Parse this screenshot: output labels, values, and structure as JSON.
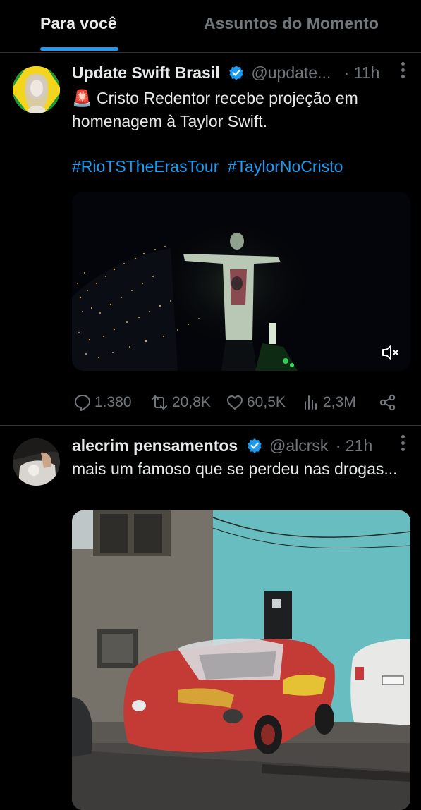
{
  "tabs": {
    "for_you": "Para você",
    "trending": "Assuntos do Momento"
  },
  "colors": {
    "accent": "#1d9bf0",
    "muted": "#71767b",
    "text": "#e7e9ea",
    "background": "#000000"
  },
  "tweets": [
    {
      "name": "Update Swift Brasil",
      "handle": "@update...",
      "dot": "·",
      "time": "11h",
      "alert_emoji": "🚨",
      "text": "Cristo Redentor recebe projeção em homenagem à Taylor Swift.",
      "hashtags": [
        "#RioTSTheErasTour",
        "#TaylorNoCristo"
      ],
      "media_icon": "mute-icon",
      "stats": {
        "replies": "1.380",
        "retweets": "20,8K",
        "likes": "60,5K",
        "views": "2,3M"
      }
    },
    {
      "name": "alecrim pensamentos",
      "handle": "@alcrsk",
      "dot": "·",
      "time": "21h",
      "text": "mais um famoso que se perdeu nas drogas..."
    }
  ]
}
